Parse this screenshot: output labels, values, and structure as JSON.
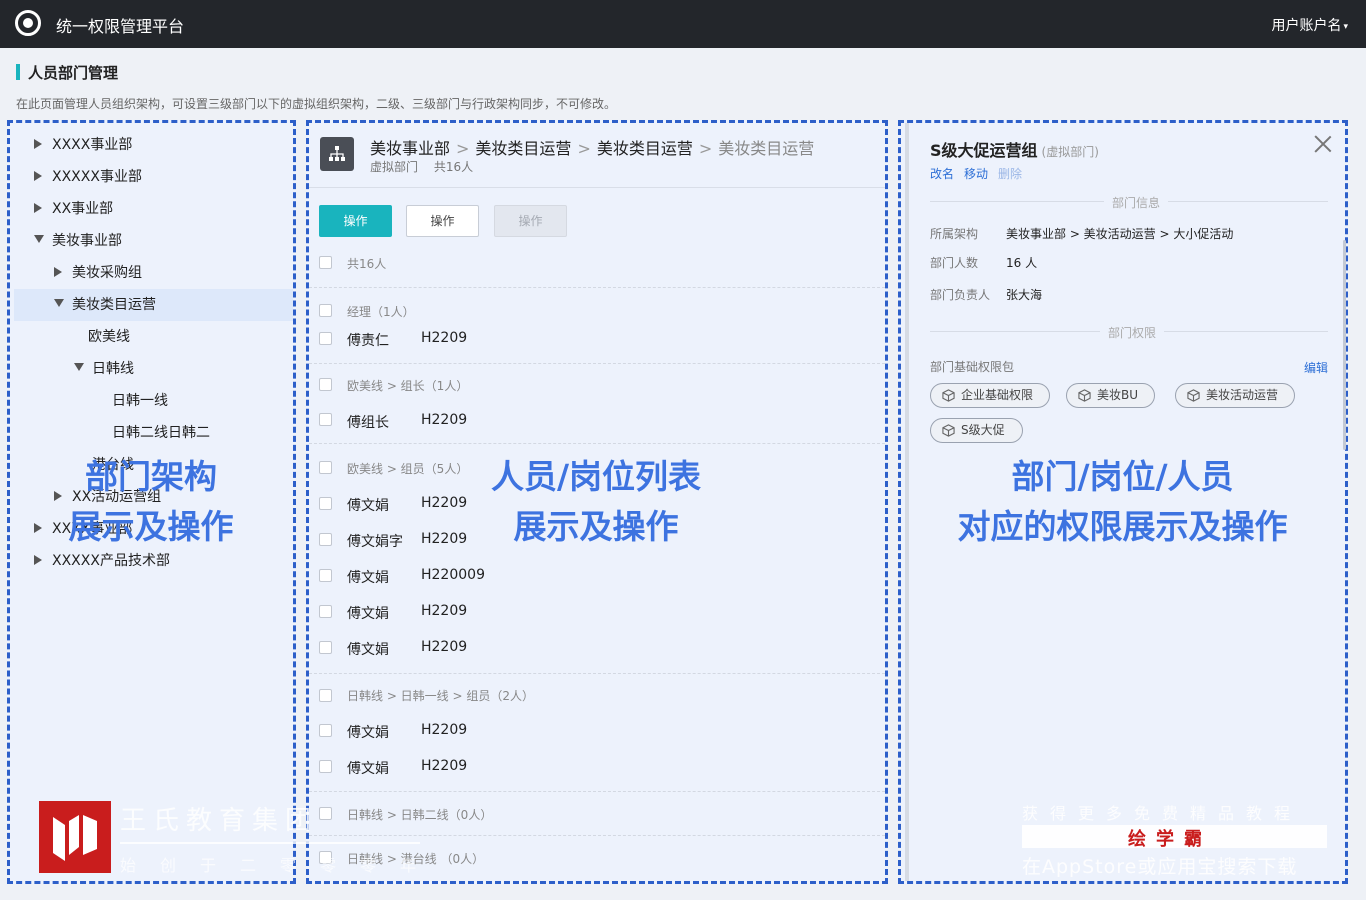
{
  "topbar": {
    "app_title": "统一权限管理平台",
    "account": "用户账户名",
    "caret": "▾"
  },
  "page": {
    "title": "人员部门管理",
    "description": "在此页面管理人员组织架构，可设置三级部门以下的虚拟组织架构，二级、三级部门与行政架构同步，不可修改。"
  },
  "tree": {
    "items": [
      {
        "label": "XXXX事业部",
        "expanded": false
      },
      {
        "label": "XXXXX事业部",
        "expanded": false
      },
      {
        "label": "XX事业部",
        "expanded": false
      },
      {
        "label": "美妆事业部",
        "expanded": true
      },
      {
        "label": "美妆采购组",
        "expanded": false
      },
      {
        "label": "美妆类目运营",
        "expanded": true,
        "selected": true
      },
      {
        "label": "欧美线"
      },
      {
        "label": "日韩线",
        "expanded": true
      },
      {
        "label": "日韩一线"
      },
      {
        "label": "日韩二线日韩二"
      },
      {
        "label": "港台线"
      },
      {
        "label": "XX活动运营组",
        "expanded": false
      },
      {
        "label": "XXXX事业部",
        "expanded": false
      },
      {
        "label": "XXXXX产品技术部",
        "expanded": false
      }
    ]
  },
  "overlays": {
    "left": [
      "部门架构",
      "展示及操作"
    ],
    "mid": [
      "人员/岗位列表",
      "展示及操作"
    ],
    "right": [
      "部门/岗位/人员",
      "对应的权限展示及操作"
    ]
  },
  "middle": {
    "breadcrumb": [
      "美妆事业部",
      "美妆类目运营",
      "美妆类目运营",
      "美妆类目运营"
    ],
    "crumb_sep": ">",
    "subtitle": "虚拟部门　 共16人",
    "buttons": {
      "primary": "操作",
      "default": "操作",
      "disabled": "操作"
    },
    "total": "共16人",
    "groups": [
      {
        "label": "经理（1人）",
        "rows": [
          {
            "name": "傅责仁",
            "code": "H2209"
          }
        ]
      },
      {
        "label": "欧美线 > 组长（1人）",
        "rows": [
          {
            "name": "傅组长",
            "code": "H2209"
          }
        ]
      },
      {
        "label": "欧美线 > 组员（5人）",
        "rows": [
          {
            "name": "傅文娟",
            "code": "H2209"
          },
          {
            "name": "傅文娟字",
            "code": "H2209"
          },
          {
            "name": "傅文娟",
            "code": "H220009"
          },
          {
            "name": "傅文娟",
            "code": "H2209"
          },
          {
            "name": "傅文娟",
            "code": "H2209"
          }
        ]
      },
      {
        "label": "日韩线 > 日韩一线 > 组员（2人）",
        "rows": [
          {
            "name": "傅文娟",
            "code": "H2209"
          },
          {
            "name": "傅文娟",
            "code": "H2209"
          }
        ]
      },
      {
        "label": "日韩线 > 日韩二线（0人）",
        "rows": []
      },
      {
        "label": "日韩线 > 港台线 （0人）",
        "rows": []
      }
    ]
  },
  "right": {
    "title": "S级大促运营组",
    "title_tag": "(虚拟部门)",
    "links": [
      "改名",
      "移动",
      "删除"
    ],
    "section_info": "部门信息",
    "info": [
      {
        "label": "所属架构",
        "value": "美妆事业部 > 美妆活动运营 > 大小促活动"
      },
      {
        "label": "部门人数",
        "value": "16 人"
      },
      {
        "label": "部门负责人",
        "value": "张大海"
      }
    ],
    "section_perm": "部门权限",
    "perm_title": "部门基础权限包",
    "edit": "编辑",
    "chips": [
      "企业基础权限",
      "美妆BU",
      "美妆活动运营",
      "S级大促"
    ]
  },
  "watermark": {
    "left_title": "王氏教育集团",
    "left_sub": "始创于二零零零年",
    "right_line1": "获得更多免费精品教程",
    "right_line2": "绘学霸",
    "right_line3": "在AppStore或应用宝搜索下载"
  },
  "colors": {
    "accent": "#19b4be",
    "link": "#2d6fd6",
    "dashed_border": "#2d5fc9",
    "overlay_text": "#3d73e0",
    "topbar": "#23262b"
  }
}
